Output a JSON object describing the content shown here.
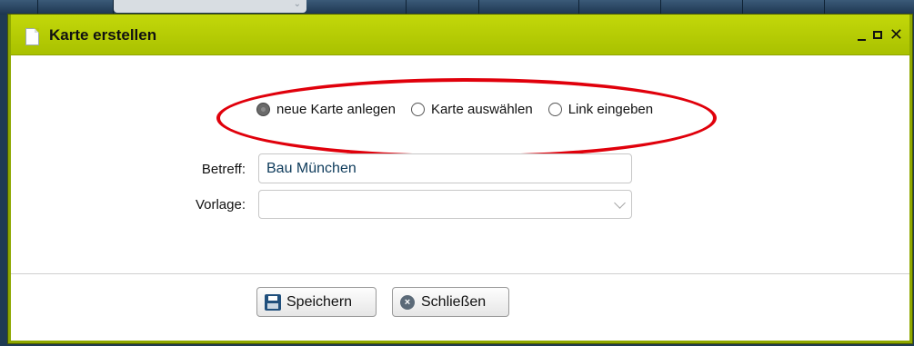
{
  "dialog": {
    "title": "Karte erstellen",
    "window_controls": {
      "minimize": "_",
      "maximize": "□",
      "close": "✕"
    }
  },
  "mode_options": [
    {
      "label": "neue Karte anlegen",
      "selected": true
    },
    {
      "label": "Karte auswählen",
      "selected": false
    },
    {
      "label": "Link eingeben",
      "selected": false
    }
  ],
  "form": {
    "subject_label": "Betreff:",
    "subject_value": "Bau München",
    "template_label": "Vorlage:",
    "template_value": ""
  },
  "buttons": {
    "save_label": "Speichern",
    "close_label": "Schließen"
  },
  "colors": {
    "titlebar": "#b5cc00",
    "annotation_ellipse": "#e0000b"
  },
  "icons": {
    "title": "document-icon",
    "save": "floppy-disk-icon",
    "close": "close-circle-icon"
  }
}
